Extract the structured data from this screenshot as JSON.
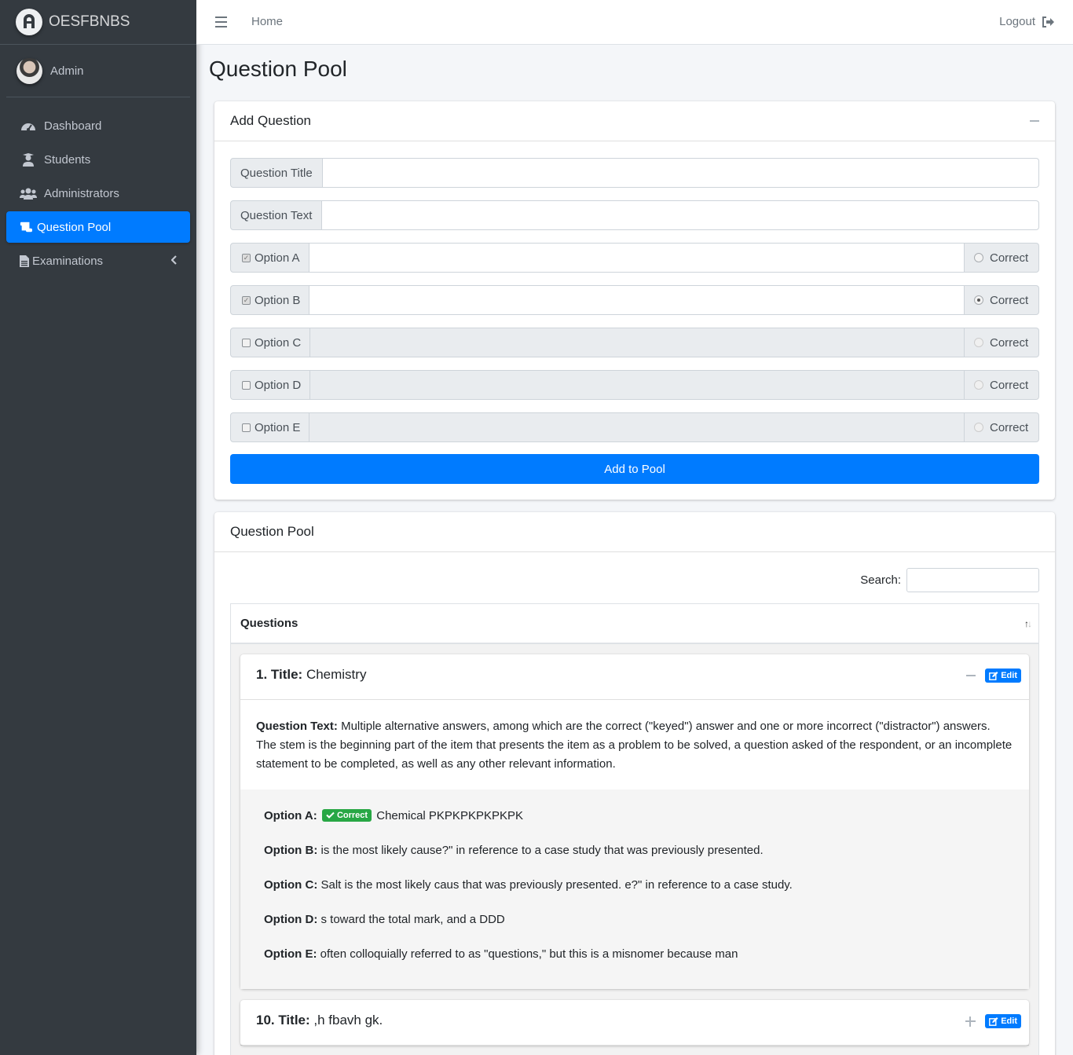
{
  "brand": {
    "name": "OESFBNBS"
  },
  "user": {
    "name": "Admin"
  },
  "sidebar": {
    "items": [
      {
        "label": "Dashboard",
        "icon": "tachometer-icon"
      },
      {
        "label": "Students",
        "icon": "user-graduate-icon"
      },
      {
        "label": "Administrators",
        "icon": "users-icon"
      },
      {
        "label": "Question Pool",
        "icon": "scroll-icon",
        "active": true
      },
      {
        "label": "Examinations",
        "icon": "file-icon"
      }
    ]
  },
  "topbar": {
    "home": "Home",
    "logout": "Logout"
  },
  "page": {
    "title": "Question Pool"
  },
  "add_question": {
    "header": "Add Question",
    "title_label": "Question Title",
    "text_label": "Question Text",
    "options": [
      {
        "label": "Option A",
        "checked": true,
        "correct": false,
        "enabled": true
      },
      {
        "label": "Option B",
        "checked": true,
        "correct": true,
        "enabled": true
      },
      {
        "label": "Option C",
        "checked": false,
        "correct": false,
        "enabled": false
      },
      {
        "label": "Option D",
        "checked": false,
        "correct": false,
        "enabled": false
      },
      {
        "label": "Option E",
        "checked": false,
        "correct": false,
        "enabled": false
      }
    ],
    "correct_label": "Correct",
    "submit": "Add to Pool"
  },
  "pool": {
    "header": "Question Pool",
    "search_label": "Search:",
    "column": "Questions",
    "edit_label": "Edit",
    "correct_badge": "Correct",
    "questions": [
      {
        "number_title": "1. Title:",
        "title": "Chemistry",
        "text_label": "Question Text:",
        "text": "Multiple alternative answers, among which are the correct (\"keyed\") answer and one or more incorrect (\"distractor\") answers. The stem is the beginning part of the item that presents the item as a problem to be solved, a question asked of the respondent, or an incomplete statement to be completed, as well as any other relevant information.",
        "options": [
          {
            "label": "Option A:",
            "text": "Chemical PKPKPKPKPKPK",
            "correct": true
          },
          {
            "label": "Option B:",
            "text": "is the most likely cause?\" in reference to a case study that was previously presented."
          },
          {
            "label": "Option C:",
            "text": "Salt is the most likely caus that was previously presented. e?\" in reference to a case study."
          },
          {
            "label": "Option D:",
            "text": "s toward the total mark, and a DDD"
          },
          {
            "label": "Option E:",
            "text": "often colloquially referred to as \"questions,\" but this is a misnomer because man"
          }
        ]
      },
      {
        "number_title": "10. Title:",
        "title": ",h fbavh gk."
      }
    ]
  },
  "colors": {
    "sidebar": "#343a40",
    "primary": "#007bff",
    "success": "#28a745",
    "background": "#f4f6f9"
  }
}
